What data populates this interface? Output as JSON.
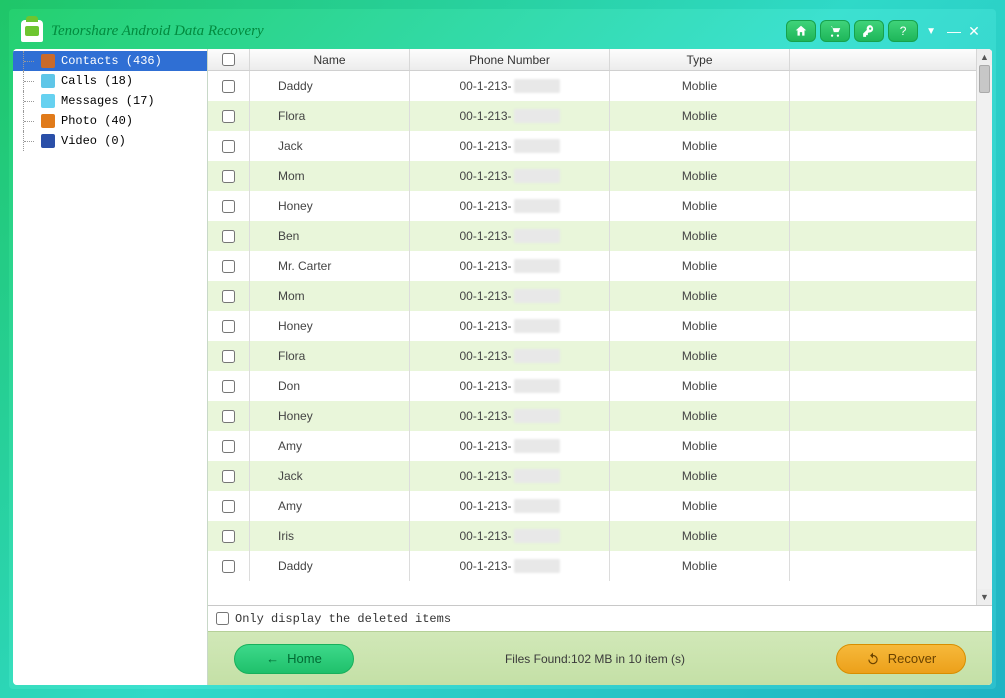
{
  "app": {
    "title": "Tenorshare Android Data Recovery"
  },
  "sidebar": {
    "items": [
      {
        "label": "Contacts (436)",
        "icon": "ic-contacts",
        "selected": true
      },
      {
        "label": "Calls (18)",
        "icon": "ic-calls",
        "selected": false
      },
      {
        "label": "Messages (17)",
        "icon": "ic-messages",
        "selected": false
      },
      {
        "label": "Photo (40)",
        "icon": "ic-photo",
        "selected": false
      },
      {
        "label": "Video (0)",
        "icon": "ic-video",
        "selected": false
      }
    ]
  },
  "table": {
    "headers": {
      "name": "Name",
      "phone": "Phone Number",
      "type": "Type"
    },
    "phone_prefix": "00-1-213-",
    "rows": [
      {
        "name": "Daddy",
        "type": "Moblie"
      },
      {
        "name": "Flora",
        "type": "Moblie"
      },
      {
        "name": "Jack",
        "type": "Moblie"
      },
      {
        "name": "Mom",
        "type": "Moblie"
      },
      {
        "name": "Honey",
        "type": "Moblie"
      },
      {
        "name": "Ben",
        "type": "Moblie"
      },
      {
        "name": "Mr. Carter",
        "type": "Moblie"
      },
      {
        "name": "Mom",
        "type": "Moblie"
      },
      {
        "name": "Honey",
        "type": "Moblie"
      },
      {
        "name": "Flora",
        "type": "Moblie"
      },
      {
        "name": "Don",
        "type": "Moblie"
      },
      {
        "name": "Honey",
        "type": "Moblie"
      },
      {
        "name": "Amy",
        "type": "Moblie"
      },
      {
        "name": "Jack",
        "type": "Moblie"
      },
      {
        "name": "Amy",
        "type": "Moblie"
      },
      {
        "name": "Iris",
        "type": "Moblie"
      },
      {
        "name": "Daddy",
        "type": "Moblie"
      }
    ]
  },
  "options": {
    "deleted_only": "Only display the deleted items"
  },
  "footer": {
    "home": "Home",
    "status": "Files Found:102 MB in 10 item (s)",
    "recover": "Recover"
  }
}
